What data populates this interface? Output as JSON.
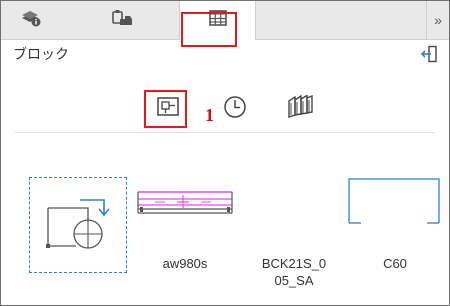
{
  "panel": {
    "title": "ブロック",
    "overflow_glyph": "»",
    "tabs": [
      {
        "icon": "layers-info-icon",
        "active": false
      },
      {
        "icon": "clipboard-paste-icon",
        "active": false
      },
      {
        "icon": "grid-table-icon",
        "active": true
      }
    ],
    "toolbar": [
      {
        "icon": "insert-block-icon",
        "selected": true,
        "annotation": "1"
      },
      {
        "icon": "clock-icon",
        "selected": false
      },
      {
        "icon": "library-books-icon",
        "selected": false
      }
    ]
  },
  "blocks": [
    {
      "name": "",
      "icon": "create-block-icon"
    },
    {
      "name": "aw980s",
      "icon": "aw980s-preview"
    },
    {
      "name": "BCK21S_0\n05_SA",
      "line1": "BCK21S_0",
      "line2": "05_SA",
      "icon": "bck21s-preview"
    },
    {
      "name": "C60",
      "icon": "c60-preview"
    }
  ],
  "colors": {
    "highlight": "#e01b1b",
    "accent_blue": "#2f7fd6",
    "magenta": "#e64ce6"
  }
}
